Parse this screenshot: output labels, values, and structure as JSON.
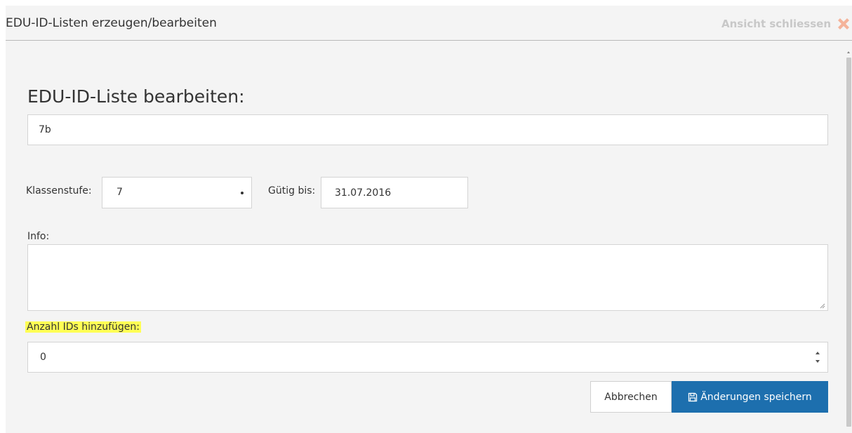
{
  "dialog": {
    "title": "EDU-ID-Listen erzeugen/bearbeiten",
    "close_label": "Ansicht schliessen",
    "close_icon": "close-icon",
    "close_icon_color": "#f4b39a"
  },
  "form": {
    "title": "EDU-ID-Liste bearbeiten:",
    "name_value": "7b",
    "level_label": "Klassenstufe:",
    "level_value": "7",
    "valid_label": "Gütig bis:",
    "valid_value": "31.07.2016",
    "info_label": "Info:",
    "info_value": "",
    "count_label": "Anzahl IDs hinzufügen:",
    "count_value": "0",
    "count_highlight_color": "#ffff55"
  },
  "actions": {
    "cancel_label": "Abbrechen",
    "save_label": "Änderungen speichern",
    "save_icon": "floppy-disk-icon",
    "primary_color": "#1d6fae"
  }
}
